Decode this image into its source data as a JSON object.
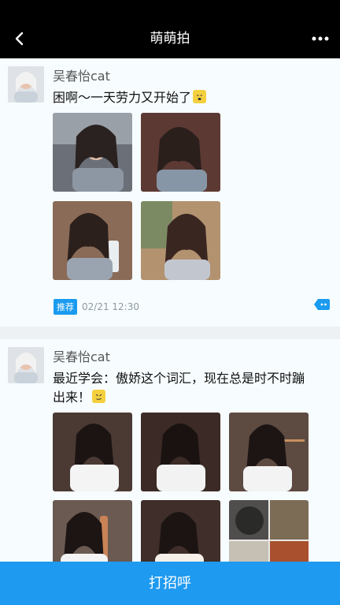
{
  "nav": {
    "title": "萌萌拍"
  },
  "posts": [
    {
      "username": "吴春怡cat",
      "text": "困啊～一天劳力又开始了",
      "tag": "推荐",
      "time": "02/21 12:30"
    },
    {
      "username": "吴春怡cat",
      "text": "最近学会：傲娇这个词汇，现在总是时不时蹦出来！"
    }
  ],
  "bottom": {
    "button_label": "打招呼"
  },
  "colors": {
    "accent": "#1e9af0",
    "nav_bg": "#000000",
    "card_bg": "#f7fdff"
  },
  "icons": [
    "back-icon",
    "more-icon",
    "emoji-sleepy-icon",
    "comment-icon",
    "emoji-smug-icon"
  ]
}
